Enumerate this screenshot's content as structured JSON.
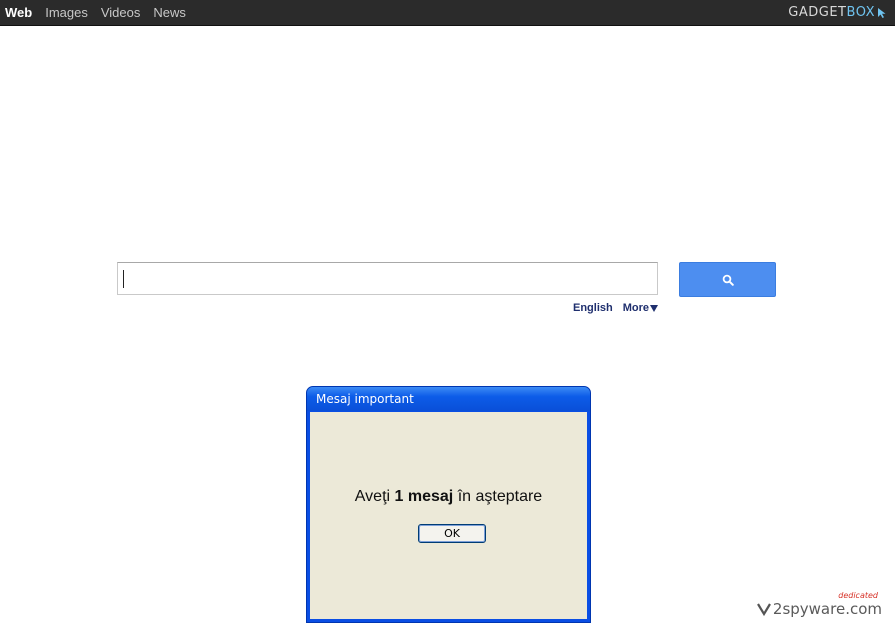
{
  "nav": {
    "items": [
      {
        "label": "Web",
        "active": true
      },
      {
        "label": "Images",
        "active": false
      },
      {
        "label": "Videos",
        "active": false
      },
      {
        "label": "News",
        "active": false
      }
    ]
  },
  "brand": {
    "part1": "GADGET",
    "part2": "BOX",
    "icon": "cursor-arrow-icon",
    "accent": "#6fc3ef"
  },
  "search": {
    "value": "",
    "button_icon": "search-icon",
    "button_color": "#4d8ef0",
    "language": "English",
    "more_label": "More"
  },
  "dialog": {
    "title": "Mesaj important",
    "message_pre": "Aveţi ",
    "message_bold": "1 mesaj",
    "message_post": " în aşteptare",
    "ok_label": "OK"
  },
  "watermark": {
    "text": "2spyware.com",
    "tag": "dedicated"
  }
}
